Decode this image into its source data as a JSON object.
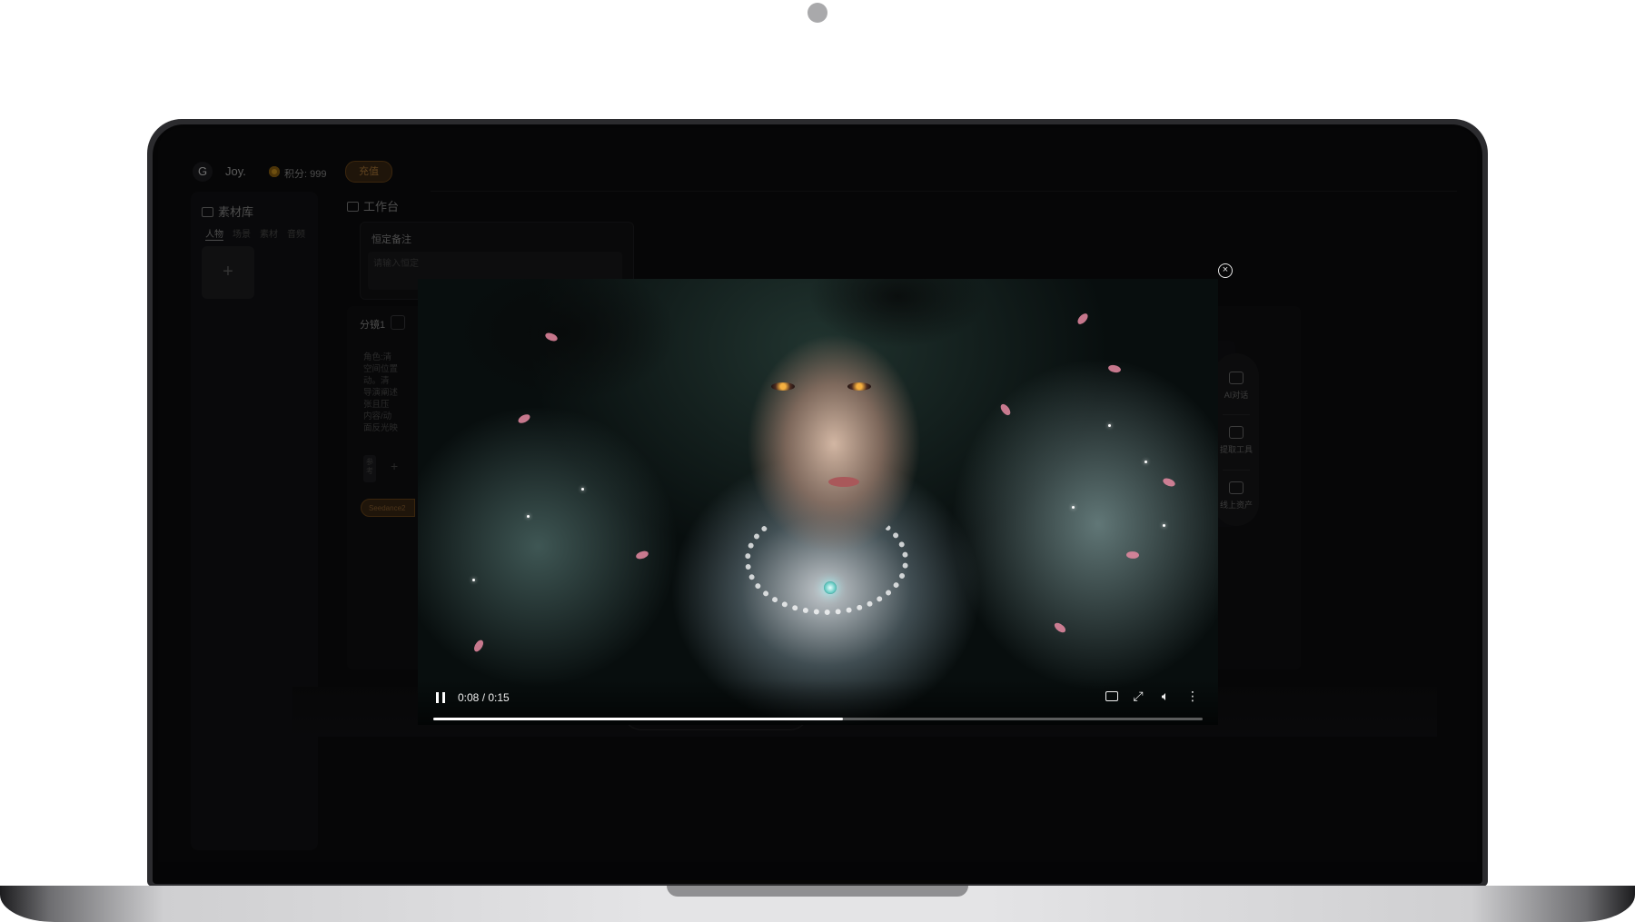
{
  "header": {
    "avatar_glyph": "G",
    "username": "Joy.",
    "points_label": "积分: 999",
    "recharge_label": "充值"
  },
  "sidebar": {
    "title": "素材库",
    "tabs": [
      "人物",
      "场景",
      "素材",
      "音频"
    ],
    "add_glyph": "+"
  },
  "workbench": {
    "title": "工作台",
    "note_title": "恒定备注",
    "note_placeholder": "请输入恒定",
    "shot_title": "分镜1",
    "shot_text": [
      "角色:清",
      "空间位置",
      "动。清",
      "导演阐述",
      "张且压",
      "内容/动",
      "面反光映"
    ],
    "ref_label": "参考",
    "ref_add": "+",
    "model_label": "Seedance2"
  },
  "tools": [
    {
      "label": "AI对话",
      "icon": "chat-icon"
    },
    {
      "label": "提取工具",
      "icon": "extract-icon"
    },
    {
      "label": "线上资产",
      "icon": "assets-icon"
    }
  ],
  "player": {
    "time": "0:08 / 0:15",
    "progress": 0.533,
    "close_glyph": "×"
  },
  "colors": {
    "accent": "#c57115",
    "screen_bg": "#0c0c0d"
  }
}
